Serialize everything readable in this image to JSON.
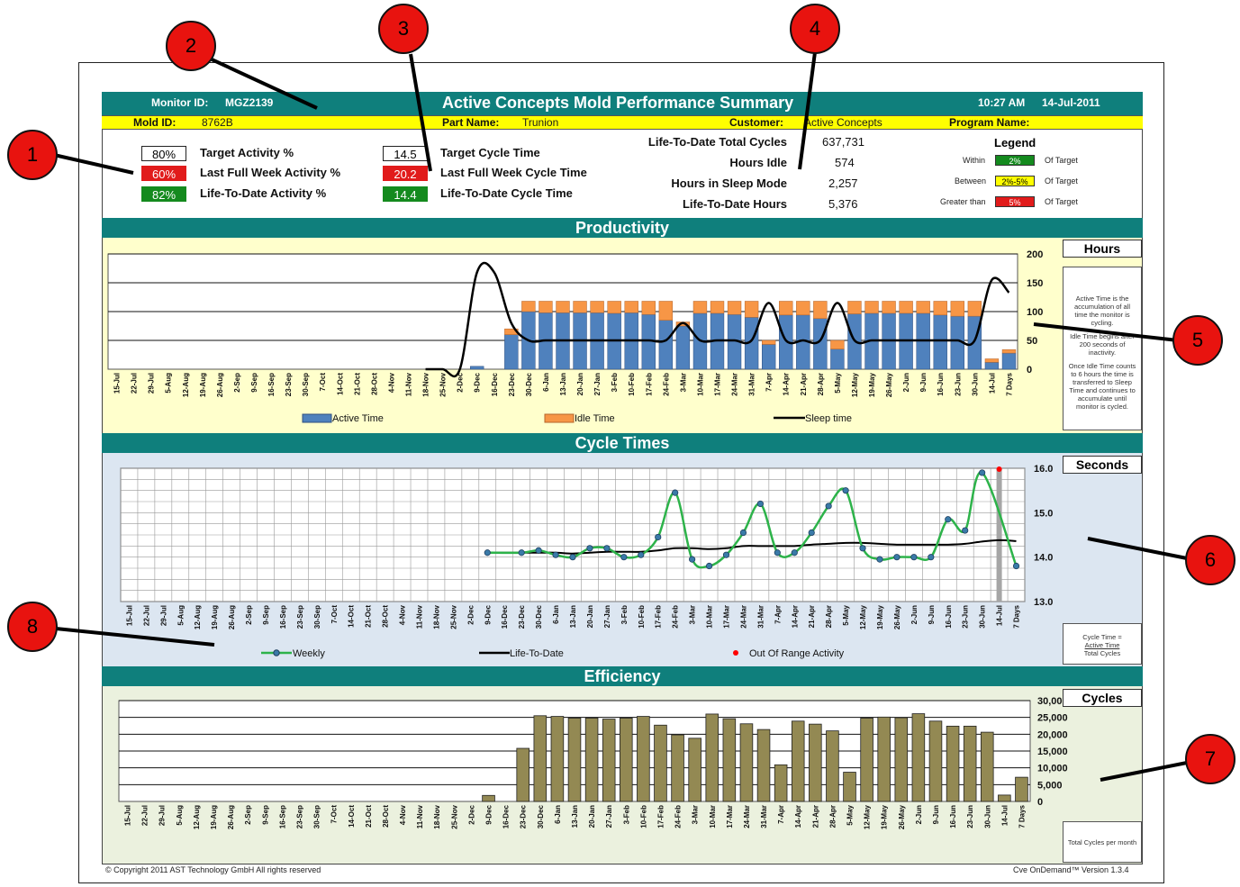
{
  "header": {
    "monitor_label": "Monitor ID:",
    "monitor_id": "MGZ2139",
    "title": "Active Concepts Mold Performance Summary",
    "time": "10:27 AM",
    "date": "14-Jul-2011",
    "mold_label": "Mold ID:",
    "mold_id": "8762B",
    "part_label": "Part Name:",
    "part_name": "Trunion",
    "customer_label": "Customer:",
    "customer": "Active Concepts",
    "program_label": "Program Name:",
    "program": ""
  },
  "kpis": {
    "target_activity": {
      "value": "80%",
      "label": "Target Activity %"
    },
    "last_week_activity": {
      "value": "60%",
      "label": "Last Full Week Activity %"
    },
    "ltd_activity": {
      "value": "82%",
      "label": "Life-To-Date Activity %"
    },
    "target_cycle": {
      "value": "14.5",
      "label": "Target Cycle Time"
    },
    "last_week_cycle": {
      "value": "20.2",
      "label": "Last Full Week Cycle Time"
    },
    "ltd_cycle": {
      "value": "14.4",
      "label": "Life-To-Date Cycle Time"
    }
  },
  "stats": {
    "total_cycles": {
      "label": "Life-To-Date Total Cycles",
      "value": "637,731"
    },
    "hours_idle": {
      "label": "Hours Idle",
      "value": "574"
    },
    "hours_sleep": {
      "label": "Hours in Sleep Mode",
      "value": "2,257"
    },
    "ltd_hours": {
      "label": "Life-To-Date Hours",
      "value": "5,376"
    }
  },
  "legend": {
    "title": "Legend",
    "rows": [
      {
        "prefix": "Within",
        "chip": "2%",
        "suffix": "Of Target",
        "color": "#148a1e",
        "text_color": "#ffffff"
      },
      {
        "prefix": "Between",
        "chip": "2%-5%",
        "suffix": "Of Target",
        "color": "#ffff00",
        "text_color": "#000000"
      },
      {
        "prefix": "Greater than",
        "chip": "5%",
        "suffix": "Of Target",
        "color": "#e11b1b",
        "text_color": "#ffffff"
      }
    ]
  },
  "sections": {
    "productivity": "Productivity",
    "cycle_times": "Cycle Times",
    "efficiency": "Efficiency"
  },
  "units": {
    "hours": "Hours",
    "seconds": "Seconds",
    "cycles": "Cycles"
  },
  "notes": {
    "productivity": [
      "Active Time is the accumulation of all time the monitor is cycling.",
      "Idle Time begins after 200 seconds of inactivity.",
      "Once Idle Time counts to 6 hours the time is transferred to Sleep Time and continues to accumulate until monitor is cycled."
    ],
    "cycle_line1": "Cycle Time =",
    "cycle_line2": "Active Time",
    "cycle_line3": "Total Cycles",
    "efficiency": "Total Cycles per month"
  },
  "footer": {
    "copyright": "Copyright 2011 AST Technology GmbH  All rights reserved",
    "version": "Cve OnDemand™ Version 1.3.4"
  },
  "callouts": [
    "1",
    "2",
    "3",
    "4",
    "5",
    "6",
    "7",
    "8"
  ],
  "colors": {
    "teal": "#0f7f7c",
    "active": "#4f81bd",
    "idle": "#f79646",
    "weekly": "#2db34a",
    "efficiency_bar": "#938953",
    "productivity_bg": "#ffffcc",
    "cycle_bg": "#dce6f1",
    "efficiency_bg": "#ebf1de"
  },
  "chart_data": [
    {
      "type": "bar",
      "title": "Productivity",
      "ylabel": "Hours",
      "ylim": [
        0,
        200
      ],
      "yticks": [
        0,
        50,
        100,
        150,
        200
      ],
      "categories": [
        "15-Jul",
        "22-Jul",
        "29-Jul",
        "5-Aug",
        "12-Aug",
        "19-Aug",
        "26-Aug",
        "2-Sep",
        "9-Sep",
        "16-Sep",
        "23-Sep",
        "30-Sep",
        "7-Oct",
        "14-Oct",
        "21-Oct",
        "28-Oct",
        "4-Nov",
        "11-Nov",
        "18-Nov",
        "25-Nov",
        "2-Dec",
        "9-Dec",
        "16-Dec",
        "23-Dec",
        "30-Dec",
        "6-Jan",
        "13-Jan",
        "20-Jan",
        "27-Jan",
        "3-Feb",
        "10-Feb",
        "17-Feb",
        "24-Feb",
        "3-Mar",
        "10-Mar",
        "17-Mar",
        "24-Mar",
        "31-Mar",
        "7-Apr",
        "14-Apr",
        "21-Apr",
        "28-Apr",
        "5-May",
        "12-May",
        "19-May",
        "26-May",
        "2-Jun",
        "9-Jun",
        "16-Jun",
        "23-Jun",
        "30-Jun",
        "14-Jul",
        "7 Days"
      ],
      "series": [
        {
          "name": "Active Time",
          "values": [
            0,
            0,
            0,
            0,
            0,
            0,
            0,
            0,
            0,
            0,
            0,
            0,
            0,
            0,
            0,
            0,
            0,
            0,
            0,
            0,
            0,
            5,
            0,
            60,
            100,
            98,
            98,
            98,
            98,
            97,
            98,
            95,
            85,
            75,
            97,
            97,
            95,
            90,
            43,
            94,
            94,
            88,
            35,
            96,
            97,
            97,
            97,
            97,
            94,
            92,
            92,
            12,
            28
          ]
        },
        {
          "name": "Idle Time",
          "values": [
            0,
            0,
            0,
            0,
            0,
            0,
            0,
            0,
            0,
            0,
            0,
            0,
            0,
            0,
            0,
            0,
            0,
            0,
            0,
            0,
            0,
            0,
            0,
            10,
            18,
            20,
            20,
            20,
            20,
            21,
            20,
            23,
            33,
            7,
            21,
            21,
            23,
            28,
            7,
            24,
            24,
            30,
            15,
            22,
            21,
            21,
            21,
            21,
            24,
            26,
            26,
            6,
            6
          ]
        },
        {
          "name": "Sleep time",
          "values": [
            0,
            0,
            0,
            0,
            0,
            0,
            0,
            0,
            0,
            0,
            0,
            0,
            0,
            0,
            0,
            0,
            0,
            0,
            0,
            0,
            0,
            168,
            168,
            80,
            50,
            50,
            50,
            50,
            50,
            50,
            50,
            50,
            50,
            80,
            50,
            50,
            50,
            50,
            115,
            50,
            50,
            50,
            115,
            50,
            50,
            50,
            50,
            50,
            50,
            50,
            50,
            155,
            133
          ]
        }
      ]
    },
    {
      "type": "line",
      "title": "Cycle Times",
      "ylabel": "Seconds",
      "ylim": [
        13.0,
        16.0
      ],
      "yticks": [
        13.0,
        14.0,
        15.0,
        16.0
      ],
      "categories": [
        "15-Jul",
        "22-Jul",
        "29-Jul",
        "5-Aug",
        "12-Aug",
        "19-Aug",
        "26-Aug",
        "2-Sep",
        "9-Sep",
        "16-Sep",
        "23-Sep",
        "30-Sep",
        "7-Oct",
        "14-Oct",
        "21-Oct",
        "28-Oct",
        "4-Nov",
        "11-Nov",
        "18-Nov",
        "25-Nov",
        "2-Dec",
        "9-Dec",
        "16-Dec",
        "23-Dec",
        "30-Dec",
        "6-Jan",
        "13-Jan",
        "20-Jan",
        "27-Jan",
        "3-Feb",
        "10-Feb",
        "17-Feb",
        "24-Feb",
        "3-Mar",
        "10-Mar",
        "17-Mar",
        "24-Mar",
        "31-Mar",
        "7-Apr",
        "14-Apr",
        "21-Apr",
        "28-Apr",
        "5-May",
        "12-May",
        "19-May",
        "26-May",
        "2-Jun",
        "9-Jun",
        "16-Jun",
        "23-Jun",
        "30-Jun",
        "14-Jul",
        "7 Days"
      ],
      "series": [
        {
          "name": "Weekly",
          "values": [
            null,
            null,
            null,
            null,
            null,
            null,
            null,
            null,
            null,
            null,
            null,
            null,
            null,
            null,
            null,
            null,
            null,
            null,
            null,
            null,
            null,
            14.1,
            null,
            14.1,
            14.15,
            14.05,
            14.0,
            14.2,
            14.2,
            14.0,
            14.05,
            14.45,
            15.45,
            13.95,
            13.8,
            14.05,
            14.55,
            15.2,
            14.1,
            14.1,
            14.55,
            15.15,
            15.5,
            14.2,
            13.95,
            14.0,
            14.0,
            14.0,
            14.85,
            14.6,
            15.9,
            null,
            13.8
          ]
        },
        {
          "name": "Life-To-Date",
          "values": [
            null,
            null,
            null,
            null,
            null,
            null,
            null,
            null,
            null,
            null,
            null,
            null,
            null,
            null,
            null,
            null,
            null,
            null,
            null,
            null,
            null,
            14.1,
            14.1,
            14.1,
            14.1,
            14.1,
            14.08,
            14.1,
            14.12,
            14.12,
            14.12,
            14.15,
            14.2,
            14.2,
            14.18,
            14.2,
            14.25,
            14.25,
            14.25,
            14.25,
            14.28,
            14.3,
            14.32,
            14.32,
            14.3,
            14.28,
            14.28,
            14.28,
            14.28,
            14.3,
            14.35,
            14.38,
            14.36
          ]
        },
        {
          "name": "Out Of Range Activity",
          "values": [
            null,
            null,
            null,
            null,
            null,
            null,
            null,
            null,
            null,
            null,
            null,
            null,
            null,
            null,
            null,
            null,
            null,
            null,
            null,
            null,
            null,
            null,
            null,
            null,
            null,
            null,
            null,
            null,
            null,
            null,
            null,
            null,
            null,
            null,
            null,
            null,
            null,
            null,
            null,
            null,
            null,
            null,
            null,
            null,
            null,
            null,
            null,
            null,
            null,
            null,
            null,
            16.0,
            null
          ]
        }
      ]
    },
    {
      "type": "bar",
      "title": "Efficiency",
      "ylabel": "Cycles",
      "ylim": [
        0,
        30000
      ],
      "yticks": [
        0,
        5000,
        10000,
        15000,
        20000,
        25000,
        30000
      ],
      "ytick_labels": [
        "0",
        "5,000",
        "10,000",
        "15,000",
        "20,000",
        "25,000",
        "30,000"
      ],
      "categories": [
        "15-Jul",
        "22-Jul",
        "29-Jul",
        "5-Aug",
        "12-Aug",
        "19-Aug",
        "26-Aug",
        "2-Sep",
        "9-Sep",
        "16-Sep",
        "23-Sep",
        "30-Sep",
        "7-Oct",
        "14-Oct",
        "21-Oct",
        "28-Oct",
        "4-Nov",
        "11-Nov",
        "18-Nov",
        "25-Nov",
        "2-Dec",
        "9-Dec",
        "16-Dec",
        "23-Dec",
        "30-Dec",
        "6-Jan",
        "13-Jan",
        "20-Jan",
        "27-Jan",
        "3-Feb",
        "10-Feb",
        "17-Feb",
        "24-Feb",
        "3-Mar",
        "10-Mar",
        "17-Mar",
        "24-Mar",
        "31-Mar",
        "7-Apr",
        "14-Apr",
        "21-Apr",
        "28-Apr",
        "5-May",
        "12-May",
        "19-May",
        "26-May",
        "2-Jun",
        "9-Jun",
        "16-Jun",
        "23-Jun",
        "30-Jun",
        "14-Jul",
        "7 Days"
      ],
      "series": [
        {
          "name": "Total Cycles",
          "values": [
            0,
            0,
            0,
            0,
            0,
            0,
            0,
            0,
            0,
            0,
            0,
            0,
            0,
            0,
            0,
            0,
            0,
            0,
            0,
            0,
            0,
            1800,
            0,
            15800,
            25500,
            25300,
            24800,
            24800,
            24500,
            24800,
            25300,
            22700,
            19800,
            18800,
            26000,
            24600,
            23100,
            21400,
            10900,
            23900,
            23000,
            21000,
            8700,
            24800,
            25100,
            24900,
            26100,
            23900,
            22400,
            22400,
            20600,
            1900,
            7200
          ]
        }
      ]
    }
  ]
}
